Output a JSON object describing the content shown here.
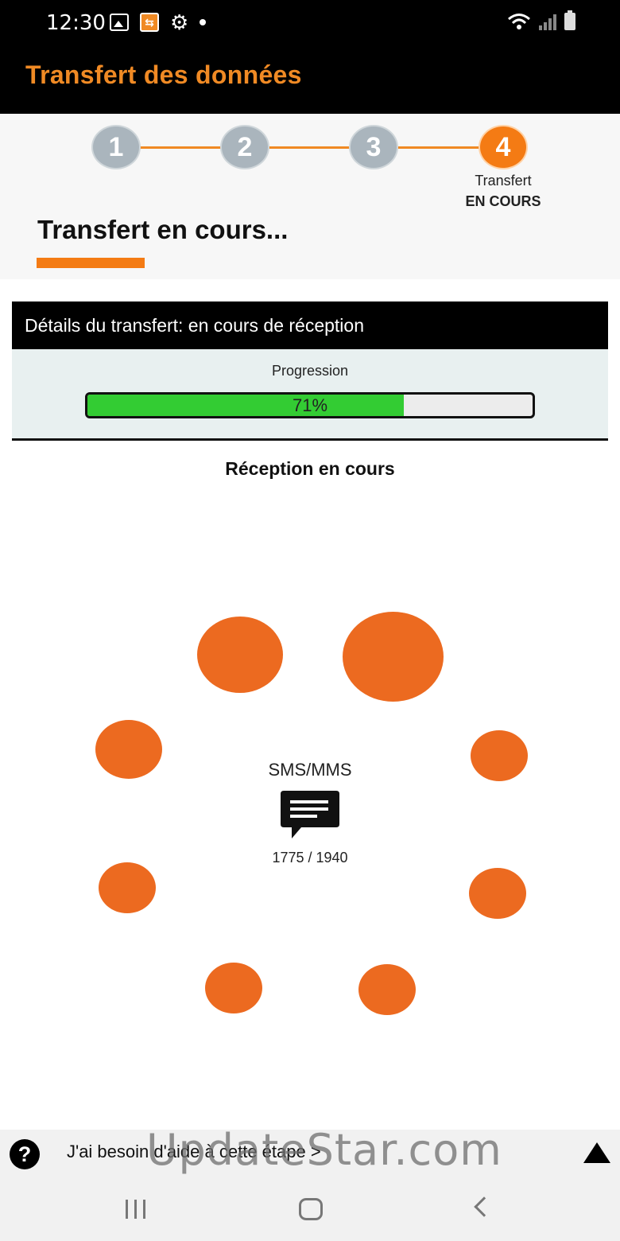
{
  "status_bar": {
    "time": "12:30",
    "icons": [
      "image-icon",
      "app-notification-icon",
      "gear-icon",
      "dot-icon",
      "wifi-icon",
      "signal-icon",
      "battery-icon"
    ]
  },
  "app_bar": {
    "title": "Transfert des données",
    "title_color": "#f08a24"
  },
  "stepper": {
    "steps": [
      {
        "number": "1",
        "state": "done"
      },
      {
        "number": "2",
        "state": "done"
      },
      {
        "number": "3",
        "state": "done"
      },
      {
        "number": "4",
        "state": "active"
      }
    ],
    "active_caption": "Transfert",
    "active_subcaption": "EN COURS",
    "accent_color": "#f47b14",
    "inactive_color": "#aab5bd"
  },
  "section": {
    "title": "Transfert en cours..."
  },
  "details": {
    "header": "Détails du transfert: en cours de réception",
    "progress_label": "Progression",
    "progress_percent": 71,
    "progress_text": "71%",
    "progress_color": "#33cc33"
  },
  "reception": {
    "title": "Réception en cours",
    "category": "SMS/MMS",
    "category_icon": "message-icon",
    "counter": "1775 / 1940",
    "spinner_color": "#ec6a20"
  },
  "help": {
    "text": "J'ai besoin d'aide à cette étape >",
    "watermark": "UpdateStar.com"
  },
  "nav": {
    "items": [
      "recent-apps-button",
      "home-button",
      "back-button"
    ]
  }
}
